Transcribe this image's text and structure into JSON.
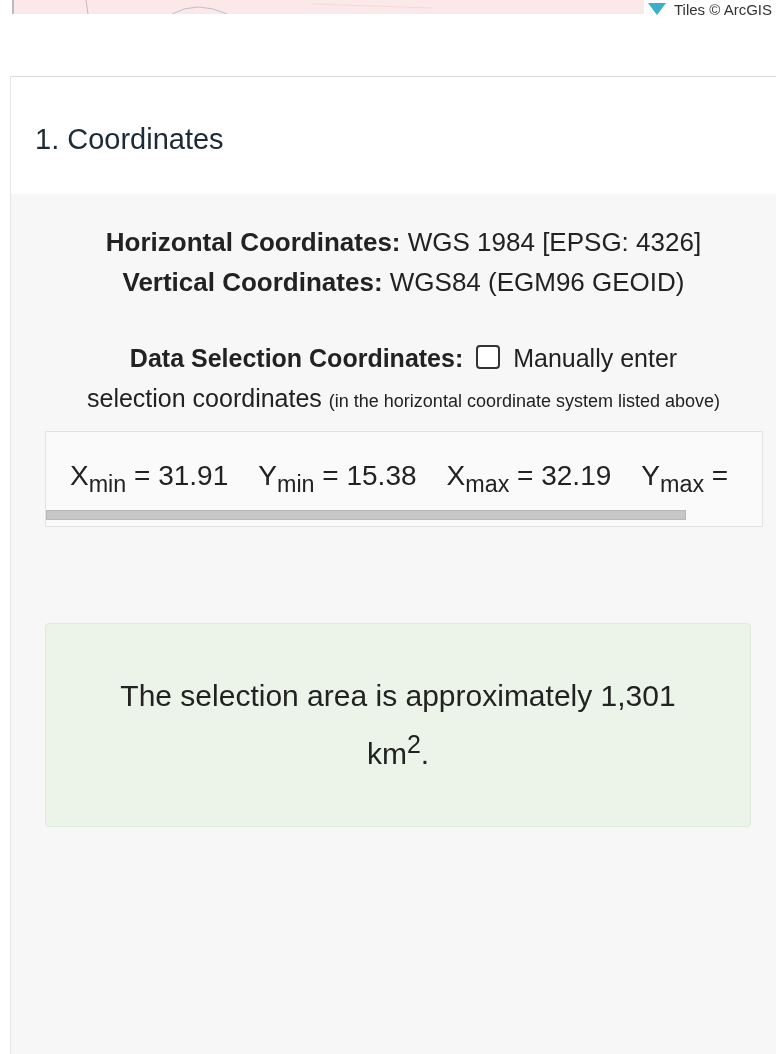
{
  "map": {
    "kind": "picture",
    "attribution": "Tiles © ArcGIS"
  },
  "section": {
    "title": "1. Coordinates",
    "coordinate_systems": [
      {
        "label": "Horizontal Coordinates:",
        "value": "WGS 1984 [EPSG: 4326]"
      },
      {
        "label": "Vertical Coordinates:",
        "value": "WGS84 (EGM96 GEOID)"
      }
    ],
    "data_selection": {
      "label": "Data Selection Coordinates:",
      "checkbox": {
        "label": "Manually enter selection coordinates",
        "checked": false
      },
      "note": "(in the horizontal coordinate system listed above)"
    },
    "bounds": [
      "X$_{min}$ = 31.91",
      "Y$_{min}$ = 15.38",
      "X$_{max}$ = 32.19",
      "Y$_{max}$ ="
    ],
    "area_message": "The selection area is approximately 1,301 km$^{2}$."
  }
}
